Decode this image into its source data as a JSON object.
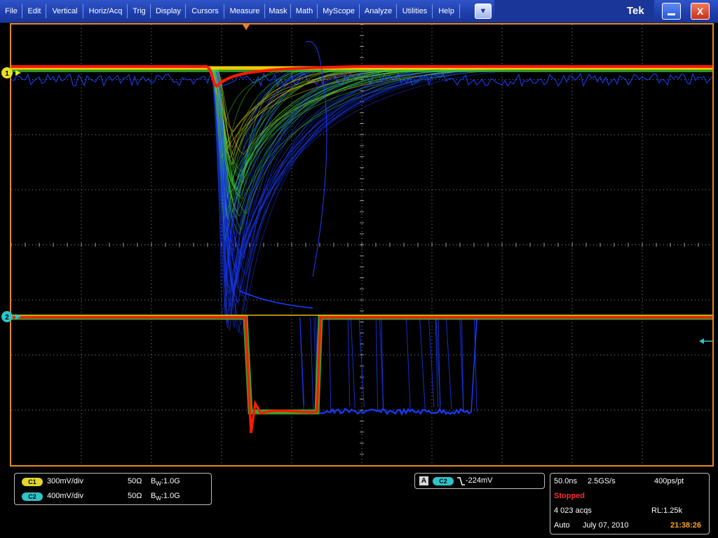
{
  "menu": {
    "items": [
      "File",
      "Edit",
      "Vertical",
      "Horiz/Acq",
      "Trig",
      "Display",
      "Cursors",
      "Measure",
      "Mask",
      "Math",
      "MyScope",
      "Analyze",
      "Utilities",
      "Help"
    ],
    "dropdown_glyph": "▼",
    "brand": "Tek",
    "minimize_icon": "minimize-icon",
    "close_label": "X"
  },
  "markers": {
    "ch1": "1",
    "ch2": "2"
  },
  "channels": [
    {
      "badge": "C1",
      "scale": "300mV/div",
      "impedance": "50Ω",
      "bw_b": "B",
      "bw_w": "W",
      "bandwidth": ":1.0G",
      "color": "#e3d62a"
    },
    {
      "badge": "C2",
      "scale": "400mV/div",
      "impedance": "50Ω",
      "bw_b": "B",
      "bw_w": "W",
      "bandwidth": ":1.0G",
      "color": "#2ec4c9"
    }
  ],
  "trigger": {
    "mode_badge": "A",
    "source": "C2",
    "level": "-224mV",
    "slope_icon": "falling-edge-icon"
  },
  "acquisition": {
    "timebase": "50.0ns",
    "sample_rate": "2.5GS/s",
    "resolution": "400ps/pt",
    "state": "Stopped",
    "acqs": "4 023 acqs",
    "record_length": "RL:1.25k",
    "trigger_mode": "Auto",
    "date": "July 07, 2010",
    "time": "21:38:26"
  },
  "colors": {
    "graticule_border": "#e08a1e",
    "menu_bar": "#1e3fae",
    "trace_hot": "#ff1a00",
    "trace_warm": "#ffd400",
    "trace_mid": "#3cd23c",
    "trace_cool": "#1a3cff"
  }
}
